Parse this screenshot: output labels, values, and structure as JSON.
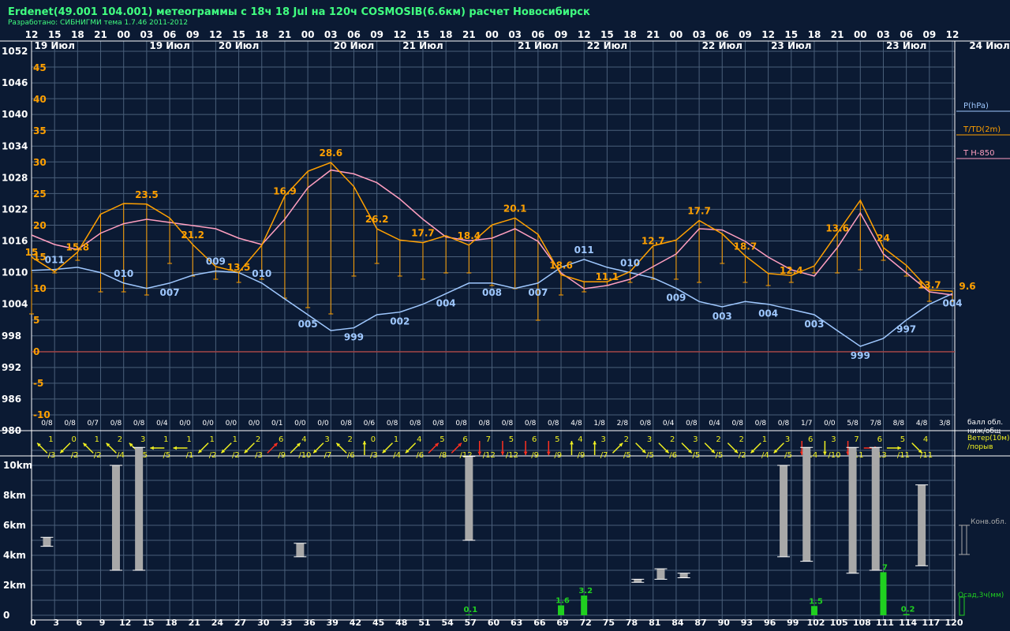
{
  "header": {
    "title": "Erdenet(49.001 104.001) метеограммы с  18ч 18 Jul на 120ч COSMOSIB(6.6км) расчет Новосибирск",
    "subtitle": "Разработано: СИБНИГМИ тема 1.7.46 2011-2012"
  },
  "colors": {
    "background": "#0b1a33",
    "grid": "#4a5f7a",
    "pressure": "#9fc8ff",
    "temperature": "#ffa000",
    "t850": "#ff9fc0",
    "dewpoint_bar": "#ffa000",
    "zero_line": "#a04040",
    "wind_arrow": "#f0f020",
    "wind_arrow_strong": "#ff3020",
    "cloud_bar": "#a8a8a8",
    "precip_bar": "#20d020",
    "text_white": "#ffffff",
    "title_text": "#40ff80"
  },
  "chart_data": {
    "type": "line",
    "x_hours": [
      0,
      3,
      6,
      9,
      12,
      15,
      18,
      21,
      24,
      27,
      30,
      33,
      36,
      39,
      42,
      45,
      48,
      51,
      54,
      57,
      60,
      63,
      66,
      69,
      72,
      75,
      78,
      81,
      84,
      87,
      90,
      93,
      96,
      99,
      102,
      105,
      108,
      111,
      114,
      117,
      120
    ],
    "top_hour_labels": [
      "12",
      "15",
      "18",
      "21",
      "00",
      "03",
      "06",
      "09",
      "12",
      "15",
      "18",
      "21",
      "00",
      "03",
      "06",
      "09",
      "12",
      "15",
      "18",
      "21",
      "00",
      "03",
      "06",
      "09",
      "12",
      "15",
      "18",
      "21",
      "00",
      "03",
      "06",
      "09",
      "12",
      "15",
      "18",
      "21",
      "00",
      "03",
      "06",
      "09",
      "12"
    ],
    "date_labels": [
      {
        "text": "19 Июл",
        "hour": 3
      },
      {
        "text": "19 Июл",
        "hour": 18
      },
      {
        "text": "20 Июл",
        "hour": 27
      },
      {
        "text": "20 Июл",
        "hour": 42
      },
      {
        "text": "21 Июл",
        "hour": 51
      },
      {
        "text": "21 Июл",
        "hour": 66
      },
      {
        "text": "22 Июл",
        "hour": 75
      },
      {
        "text": "22 Июл",
        "hour": 90
      },
      {
        "text": "23 Июл",
        "hour": 99
      },
      {
        "text": "23 Июл",
        "hour": 114
      }
    ],
    "end_date_label": "24 Июл",
    "pressure_axis": {
      "ticks": [
        1052,
        1046,
        1040,
        1034,
        1028,
        1022,
        1016,
        1010,
        1004,
        998,
        992,
        986,
        980
      ],
      "min": 980,
      "max": 1052
    },
    "temperature_axis": {
      "ticks": [
        45,
        40,
        35,
        30,
        25,
        20,
        15,
        10,
        5,
        0,
        -5,
        -10
      ],
      "min": -10,
      "max": 45
    },
    "pressure": [
      1010.4,
      1010.6,
      1011.0,
      1010.0,
      1008.0,
      1007.0,
      1008.0,
      1009.5,
      1010.3,
      1010.0,
      1008.0,
      1005.0,
      1002.0,
      999.0,
      999.5,
      1002.0,
      1002.5,
      1004.0,
      1006.0,
      1008.0,
      1008.0,
      1007.0,
      1008.0,
      1011.0,
      1012.5,
      1011.0,
      1010.0,
      1009.0,
      1007.0,
      1004.5,
      1003.5,
      1004.5,
      1004.0,
      1003.0,
      1002.0,
      999.0,
      996.0,
      997.5,
      1001.0,
      1004.0,
      1006.0
    ],
    "pressure_labels": [
      {
        "text": "011",
        "hour": 3
      },
      {
        "text": "010",
        "hour": 12
      },
      {
        "text": "007",
        "hour": 18
      },
      {
        "text": "009",
        "hour": 24
      },
      {
        "text": "010",
        "hour": 30
      },
      {
        "text": "005",
        "hour": 36
      },
      {
        "text": "999",
        "hour": 42
      },
      {
        "text": "002",
        "hour": 48
      },
      {
        "text": "004",
        "hour": 54
      },
      {
        "text": "008",
        "hour": 60
      },
      {
        "text": "007",
        "hour": 66
      },
      {
        "text": "011",
        "hour": 72
      },
      {
        "text": "010",
        "hour": 78
      },
      {
        "text": "009",
        "hour": 84
      },
      {
        "text": "003",
        "hour": 90
      },
      {
        "text": "004",
        "hour": 96
      },
      {
        "text": "003",
        "hour": 102
      },
      {
        "text": "999",
        "hour": 108
      },
      {
        "text": "997",
        "hour": 114
      },
      {
        "text": "004",
        "hour": 120
      }
    ],
    "temperature": [
      15.0,
      12.7,
      15.8,
      21.8,
      23.5,
      23.4,
      21.2,
      17.0,
      13.5,
      12.6,
      16.9,
      24.7,
      28.6,
      30.0,
      26.2,
      19.5,
      17.7,
      17.3,
      18.4,
      16.9,
      20.1,
      21.2,
      18.6,
      12.2,
      11.1,
      11.1,
      12.7,
      16.8,
      17.7,
      20.8,
      18.7,
      15.2,
      12.4,
      12.1,
      13.6,
      18.8,
      24.0,
      16.5,
      13.7,
      9.8,
      9.6
    ],
    "temperature_labels": [
      {
        "text": "15",
        "hour": 0
      },
      {
        "text": "15.8",
        "hour": 6
      },
      {
        "text": "23.5",
        "hour": 15
      },
      {
        "text": "21.2",
        "hour": 21
      },
      {
        "text": "13.5",
        "hour": 27
      },
      {
        "text": "16.9",
        "hour": 33
      },
      {
        "text": "28.6",
        "hour": 39
      },
      {
        "text": "26.2",
        "hour": 45
      },
      {
        "text": "17.7",
        "hour": 51
      },
      {
        "text": "18.4",
        "hour": 57
      },
      {
        "text": "20.1",
        "hour": 63
      },
      {
        "text": "18.6",
        "hour": 69
      },
      {
        "text": "11.1",
        "hour": 75
      },
      {
        "text": "12.7",
        "hour": 81
      },
      {
        "text": "17.7",
        "hour": 87
      },
      {
        "text": "18.7",
        "hour": 93
      },
      {
        "text": "12.4",
        "hour": 99
      },
      {
        "text": "13.6",
        "hour": 105
      },
      {
        "text": "24",
        "hour": 111
      },
      {
        "text": "13.7",
        "hour": 117
      },
      {
        "text": "9.6",
        "hour": 123
      }
    ],
    "dewpoint": [
      6.0,
      12.5,
      14.5,
      9.5,
      9.5,
      9.0,
      14.0,
      12.0,
      11.5,
      11.0,
      11.5,
      8.5,
      7.0,
      6.0,
      12.0,
      14.0,
      12.0,
      11.5,
      12.5,
      12.5,
      10.5,
      10.0,
      5.0,
      9.0,
      9.5,
      10.5,
      11.0,
      11.5,
      11.5,
      11.0,
      14.0,
      11.0,
      10.5,
      11.0,
      12.5,
      12.5,
      13.0,
      14.5,
      12.0,
      8.0,
      8.0
    ],
    "t850": [
      18.5,
      17.0,
      16.2,
      18.8,
      20.3,
      21.0,
      20.5,
      20.0,
      19.5,
      18.0,
      17.0,
      21.0,
      26.0,
      28.8,
      28.2,
      26.8,
      24.2,
      21.0,
      18.2,
      17.6,
      18.0,
      19.5,
      17.5,
      12.5,
      10.0,
      10.5,
      11.5,
      13.5,
      15.5,
      19.5,
      19.3,
      17.5,
      15.0,
      13.0,
      12.0,
      16.5,
      22.0,
      15.5,
      12.5,
      9.5,
      9.0
    ],
    "cloud_labels": [
      "0/8",
      "0/8",
      "0/7",
      "0/8",
      "0/8",
      "0/4",
      "0/0",
      "0/0",
      "0/0",
      "0/0",
      "0/1",
      "0/0",
      "0/0",
      "0/8",
      "0/6",
      "0/8",
      "0/8",
      "0/8",
      "0/8",
      "0/8",
      "0/8",
      "0/8",
      "0/8",
      "4/8",
      "1/8",
      "2/8",
      "0/8",
      "0/4",
      "0/8",
      "0/4",
      "0/8",
      "0/8",
      "0/8",
      "1/7",
      "0/0",
      "5/8",
      "7/8",
      "8/8",
      "4/8",
      "3/8"
    ],
    "wind_speed": [
      "1",
      "0",
      "1",
      "2",
      "3",
      "1",
      "1",
      "1",
      "1",
      "2",
      "6",
      "4",
      "3",
      "2",
      "0",
      "1",
      "4",
      "5",
      "6",
      "7",
      "5",
      "6",
      "5",
      "4",
      "3",
      "2",
      "3",
      "2",
      "3",
      "2",
      "2",
      "1",
      "3",
      "6",
      "3",
      "7",
      "6",
      "5",
      "4"
    ],
    "wind_gust": [
      "/3",
      "/2",
      "/2",
      "/4",
      "/5",
      "/5",
      "/1",
      "/2",
      "/2",
      "/3",
      "/9",
      "/10",
      "/7",
      "/6",
      "/3",
      "/4",
      "/6",
      "/8",
      "/12",
      "/12",
      "/12",
      "/9",
      "/9",
      "/9",
      "/7",
      "/5",
      "/5",
      "/6",
      "/5",
      "/5",
      "/2",
      "/4",
      "/5",
      "/14",
      "/10",
      "/11",
      "/13",
      "/11",
      "/11",
      "/8"
    ],
    "wind_dir_deg": [
      135,
      225,
      135,
      135,
      135,
      180,
      180,
      225,
      225,
      225,
      45,
      45,
      225,
      135,
      90,
      225,
      225,
      45,
      45,
      270,
      270,
      270,
      270,
      90,
      90,
      45,
      315,
      315,
      315,
      315,
      315,
      225,
      225,
      270,
      270,
      270,
      0,
      0,
      315,
      315
    ],
    "wind_strong": [
      false,
      false,
      false,
      false,
      false,
      false,
      false,
      false,
      false,
      false,
      true,
      false,
      false,
      false,
      false,
      false,
      false,
      true,
      true,
      true,
      true,
      true,
      true,
      false,
      false,
      false,
      false,
      false,
      false,
      false,
      false,
      false,
      false,
      true,
      false,
      true,
      true,
      false,
      false,
      false
    ],
    "cloud_axis": {
      "ticks": [
        "10km",
        "8km",
        "6km",
        "4km",
        "2km",
        "0"
      ],
      "values_km": [
        10,
        8,
        6,
        4,
        2,
        0
      ],
      "max_km": 11
    },
    "conv_clouds": [
      {
        "hour": 2,
        "base_km": 4.6,
        "top_km": 5.2
      },
      {
        "hour": 11,
        "base_km": 3.0,
        "top_km": 10.0
      },
      {
        "hour": 14,
        "base_km": 3.0,
        "top_km": 11.2
      },
      {
        "hour": 35,
        "base_km": 3.9,
        "top_km": 4.8
      },
      {
        "hour": 57,
        "base_km": 5.0,
        "top_km": 10.6
      },
      {
        "hour": 79,
        "base_km": 2.2,
        "top_km": 2.4
      },
      {
        "hour": 82,
        "base_km": 2.4,
        "top_km": 3.1
      },
      {
        "hour": 85,
        "base_km": 2.5,
        "top_km": 2.8
      },
      {
        "hour": 98,
        "base_km": 3.9,
        "top_km": 10.0
      },
      {
        "hour": 101,
        "base_km": 3.6,
        "top_km": 11.2
      },
      {
        "hour": 107,
        "base_km": 2.8,
        "top_km": 11.2
      },
      {
        "hour": 110,
        "base_km": 3.0,
        "top_km": 11.2
      },
      {
        "hour": 116,
        "base_km": 3.3,
        "top_km": 8.7
      }
    ],
    "precipitation": [
      {
        "hour": 57,
        "value": 0.1,
        "label": "0.1"
      },
      {
        "hour": 69,
        "value": 1.6,
        "label": "1.6"
      },
      {
        "hour": 72,
        "value": 3.2,
        "label": "3.2"
      },
      {
        "hour": 102,
        "value": 1.5,
        "label": "1.5"
      },
      {
        "hour": 111,
        "value": 7,
        "label": "7"
      },
      {
        "hour": 114,
        "value": 0.2,
        "label": "0.2"
      }
    ],
    "bottom_hour_labels": [
      "0",
      "3",
      "6",
      "9",
      "12",
      "15",
      "18",
      "21",
      "24",
      "27",
      "30",
      "33",
      "36",
      "39",
      "42",
      "45",
      "48",
      "51",
      "54",
      "57",
      "60",
      "63",
      "66",
      "69",
      "72",
      "75",
      "78",
      "81",
      "84",
      "87",
      "90",
      "93",
      "96",
      "99",
      "102",
      "105",
      "108",
      "111",
      "114",
      "117",
      "120"
    ],
    "legend": {
      "pressure": "P(hPa)",
      "temperature": "T/TD(2m)",
      "t850": "T H-850",
      "cloud_amount": "балл обл. ниж/общ",
      "wind": "Ветер(10м)/порыв",
      "conv_cloud": "Конв.обл.",
      "precip": "Осад,3ч(мм)"
    }
  }
}
